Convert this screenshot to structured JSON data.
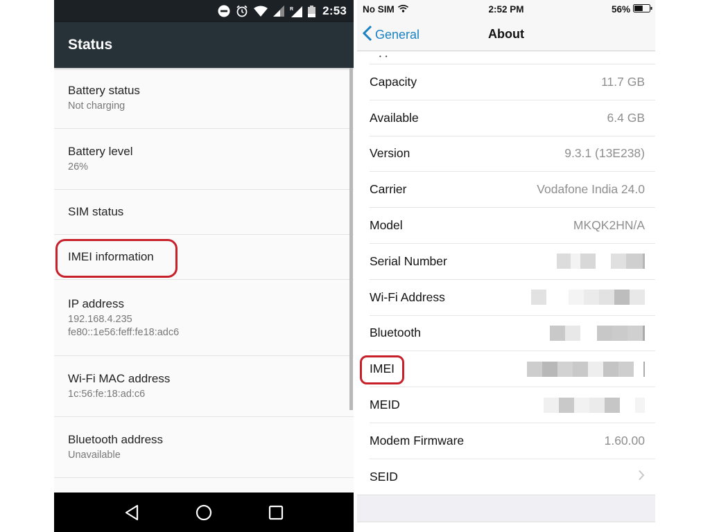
{
  "android": {
    "status_bar": {
      "icons": [
        "do-not-disturb-icon",
        "alarm-icon",
        "wifi-icon",
        "signal-icon",
        "signal-roaming-icon",
        "battery-icon"
      ],
      "time": "2:53"
    },
    "app_bar": {
      "title": "Status"
    },
    "items": [
      {
        "label": "Battery status",
        "sub": "Not charging"
      },
      {
        "label": "Battery level",
        "sub": "26%"
      },
      {
        "label": "SIM status"
      },
      {
        "label": "IMEI information",
        "highlighted": true
      },
      {
        "label": "IP address",
        "sub": "192.168.4.235",
        "sub2": "fe80::1e56:feff:fe18:adc6"
      },
      {
        "label": "Wi-Fi MAC address",
        "sub": "1c:56:fe:18:ad:c6"
      },
      {
        "label": "Bluetooth address",
        "sub": "Unavailable"
      }
    ],
    "nav_bar": [
      "back-icon",
      "home-icon",
      "recents-icon"
    ]
  },
  "ios": {
    "status_bar": {
      "carrier": "No SIM",
      "time": "2:52 PM",
      "battery": "56%",
      "battery_level": 0.56
    },
    "nav_bar": {
      "back_label": "General",
      "title": "About"
    },
    "rows": [
      {
        "label": "Capacity",
        "value": "11.7 GB"
      },
      {
        "label": "Available",
        "value": "6.4 GB"
      },
      {
        "label": "Version",
        "value": "9.3.1 (13E238)"
      },
      {
        "label": "Carrier",
        "value": "Vodafone India 24.0"
      },
      {
        "label": "Model",
        "value": "MKQK2HN/A"
      },
      {
        "label": "Serial Number",
        "value": "[blurred]"
      },
      {
        "label": "Wi-Fi Address",
        "value": "[blurred]"
      },
      {
        "label": "Bluetooth",
        "value": "[blurred]"
      },
      {
        "label": "IMEI",
        "value": "[blurred]",
        "highlighted": true
      },
      {
        "label": "MEID",
        "value": "[blurred]"
      },
      {
        "label": "Modem Firmware",
        "value": "1.60.00"
      },
      {
        "label": "SEID",
        "value": ""
      }
    ]
  },
  "colors": {
    "android_appbar": "#263238",
    "android_statusbar": "#1b2124",
    "ios_accent": "#1a82c4",
    "highlight": "#c8202a"
  }
}
